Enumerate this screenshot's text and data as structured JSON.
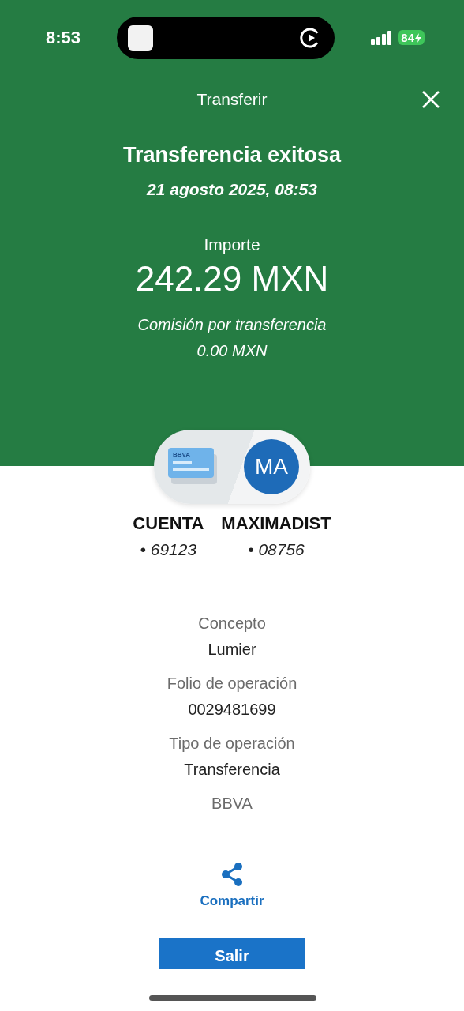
{
  "status_bar": {
    "time": "8:53",
    "battery": "84"
  },
  "header": {
    "title": "Transferir"
  },
  "result": {
    "heading": "Transferencia exitosa",
    "date": "21 agosto 2025, 08:53",
    "amount_label": "Importe",
    "amount": "242.29 MXN",
    "fee_label": "Comisión por transferencia",
    "fee": "0.00 MXN"
  },
  "parties": {
    "card_brand": "BBVA",
    "avatar_initials": "MA",
    "from": {
      "name": "CUENTA",
      "number": "• 69123"
    },
    "to": {
      "name": "MAXIMADIST",
      "number": "• 08756"
    }
  },
  "details": [
    {
      "label": "Concepto",
      "value": "Lumier"
    },
    {
      "label": "Folio de operación",
      "value": "0029481699"
    },
    {
      "label": "Tipo de operación",
      "value": "Transferencia"
    },
    {
      "label": "BBVA"
    }
  ],
  "share": {
    "label": "Compartir"
  },
  "exit_button": {
    "label": "Salir"
  }
}
